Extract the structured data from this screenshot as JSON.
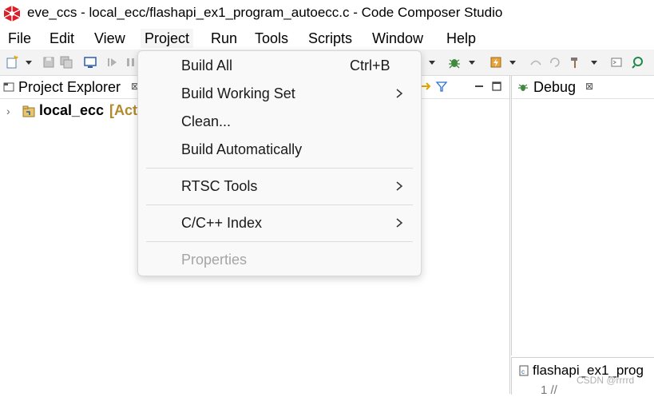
{
  "window": {
    "title": "eve_ccs - local_ecc/flashapi_ex1_program_autoecc.c - Code Composer Studio"
  },
  "menubar": {
    "items": [
      "File",
      "Edit",
      "View",
      "Project",
      "Run",
      "Tools",
      "Scripts",
      "Window",
      "Help"
    ],
    "active": "Project"
  },
  "project_explorer": {
    "tab_label": "Project Explorer",
    "tab_close": "⊠",
    "project_name": "local_ecc",
    "project_status": "[Act"
  },
  "debug": {
    "tab_label": "Debug",
    "tab_close": "⊠"
  },
  "editor": {
    "tab_label": "flashapi_ex1_prog",
    "first_line": "1  //"
  },
  "watermark": "CSDN @rrrrd",
  "project_menu": {
    "items": [
      {
        "label": "Build All",
        "shortcut": "Ctrl+B",
        "submenu": false,
        "enabled": true
      },
      {
        "label": "Build Working Set",
        "shortcut": "",
        "submenu": true,
        "enabled": true
      },
      {
        "label": "Clean...",
        "shortcut": "",
        "submenu": false,
        "enabled": true
      },
      {
        "label": "Build Automatically",
        "shortcut": "",
        "submenu": false,
        "enabled": true
      },
      {
        "label": "RTSC Tools",
        "shortcut": "",
        "submenu": true,
        "enabled": true
      },
      {
        "label": "C/C++ Index",
        "shortcut": "",
        "submenu": true,
        "enabled": true
      },
      {
        "label": "Properties",
        "shortcut": "",
        "submenu": false,
        "enabled": false
      }
    ]
  },
  "colors": {
    "app_icon": "#d81f2a",
    "active_project_status": "#b38a2e",
    "menu_bg": "#f9f9f9",
    "toolbar_bg": "#f3f3f3"
  }
}
